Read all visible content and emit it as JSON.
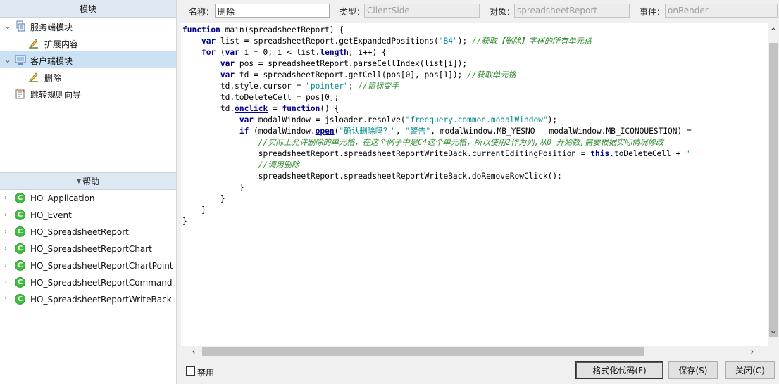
{
  "left_panel": {
    "modules_header": "模块",
    "tree": [
      {
        "label": "服务端模块",
        "level": 0,
        "expanded": true
      },
      {
        "label": "扩展内容",
        "level": 1
      },
      {
        "label": "客户端模块",
        "level": 0,
        "expanded": true,
        "selected": true
      },
      {
        "label": "删除",
        "level": 1
      },
      {
        "label": "跳转规则向导",
        "level": 0
      }
    ],
    "help_header": "帮助",
    "help_items": [
      "HO_Application",
      "HO_Event",
      "HO_SpreadsheetReport",
      "HO_SpreadsheetReportChart",
      "HO_SpreadsheetReportChartPoint",
      "HO_SpreadsheetReportCommand",
      "HO_SpreadsheetReportWriteBack"
    ]
  },
  "fields": {
    "name_label": "名称：",
    "name_value": "删除",
    "type_label": "类型：",
    "type_value": "ClientSide",
    "object_label": "对象：",
    "object_value": "spreadsheetReport",
    "event_label": "事件：",
    "event_value": "onRender"
  },
  "code_lines": [
    "function main(spreadsheetReport) {",
    "    var list = spreadsheetReport.getExpandedPositions(\"B4\"); //获取【删除】字样的所有单元格",
    "    for (var i = 0; i < list.length; i++) {",
    "        var pos = spreadsheetReport.parseCellIndex(list[i]);",
    "        var td = spreadsheetReport.getCell(pos[0], pos[1]); //获取单元格",
    "        td.style.cursor = \"pointer\"; //鼠标变手",
    "        td.toDeleteCell = pos[0];",
    "        td.onclick = function() {",
    "            var modalWindow = jsloader.resolve(\"freequery.common.modalWindow\");",
    "            if (modalWindow.open(\"确认删除吗？\", \"警告\", modalWindow.MB_YESNO | modalWindow.MB_ICONQUESTION) =",
    "                //实际上允许删除的单元格，在这个例子中是C4这个单元格，所以使用2作为列,从0 开始数,需要根据实际情况修改",
    "                spreadsheetReport.spreadsheetReportWriteBack.currentEditingPosition = this.toDeleteCell + \"",
    "                //调用删除",
    "                spreadsheetReport.spreadsheetReportWriteBack.doRemoveRowClick();",
    "            }",
    "        }",
    "    }",
    "}"
  ],
  "bottom": {
    "disable_label": "禁用",
    "format_button": "格式化代码(F)",
    "save_button": "保存(S)",
    "close_button": "关闭(C)"
  }
}
